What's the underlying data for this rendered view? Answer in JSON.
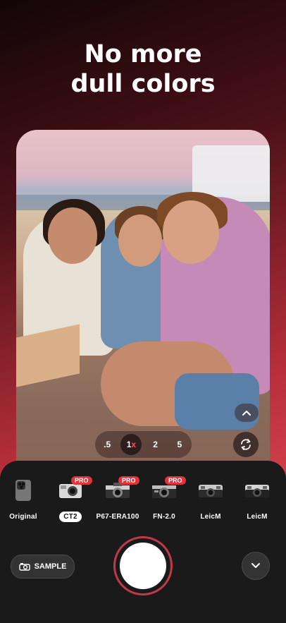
{
  "headline": {
    "line1": "No more",
    "line2": "dull colors"
  },
  "zoom": {
    "options": [
      ".5",
      "1",
      "2",
      "5"
    ],
    "active_suffix": "x",
    "active_index": 1
  },
  "filters": [
    {
      "label": "Original",
      "pro": false,
      "selected": false,
      "icon": "iphone-camera-icon"
    },
    {
      "label": "CT2",
      "pro": true,
      "selected": true,
      "icon": "compact-camera-icon"
    },
    {
      "label": "P67-ERA100",
      "pro": true,
      "selected": false,
      "icon": "film-camera-icon"
    },
    {
      "label": "FN-2.0",
      "pro": true,
      "selected": false,
      "icon": "film-camera-icon"
    },
    {
      "label": "LeicM",
      "pro": false,
      "selected": false,
      "icon": "rangefinder-camera-icon"
    },
    {
      "label": "LeicM",
      "pro": false,
      "selected": false,
      "icon": "rangefinder-camera-icon"
    }
  ],
  "pro_badge": "PRO",
  "sample_button": {
    "label": "SAMPLE",
    "icon": "camera-icon"
  },
  "colors": {
    "accent": "#e0343a",
    "ring": "#c0394a",
    "panel": "#1a1a1a"
  }
}
